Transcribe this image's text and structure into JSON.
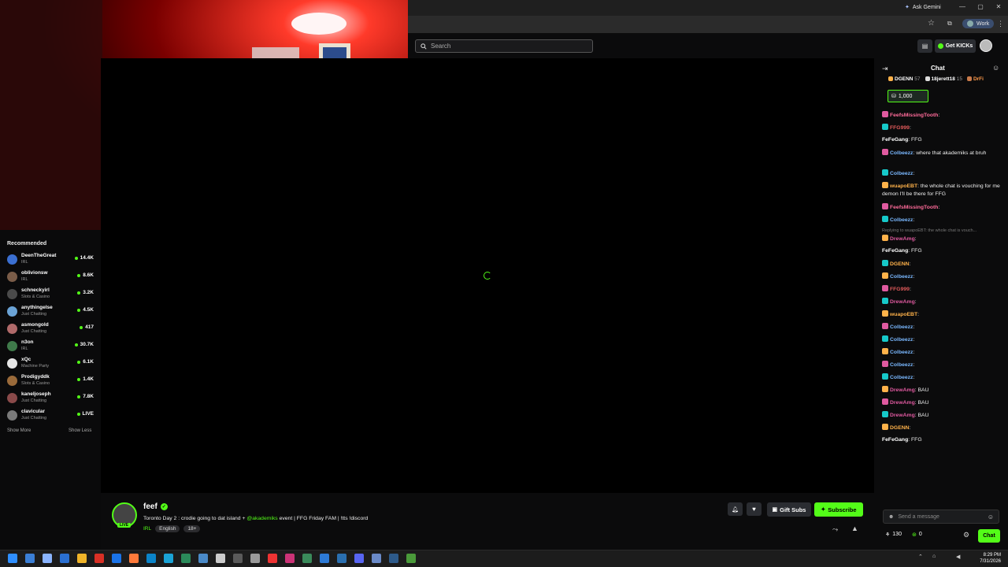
{
  "browser": {
    "ask_gemini": "Ask Gemini",
    "profile": "Work"
  },
  "header": {
    "search_placeholder": "Search",
    "get_kicks": "Get KICKs"
  },
  "sidebar": {
    "title": "Recommended",
    "items": [
      {
        "name": "DeenTheGreat",
        "category": "IRL",
        "viewers": "14.4K",
        "color": "#3b6fd1"
      },
      {
        "name": "oblivionsw",
        "category": "IRL",
        "viewers": "8.6K",
        "color": "#7a5c48"
      },
      {
        "name": "schneckyirl",
        "category": "Slots & Casino",
        "viewers": "3.2K",
        "color": "#4a4a4a"
      },
      {
        "name": "anythingelse",
        "category": "Just Chatting",
        "viewers": "4.5K",
        "color": "#6ba3d6"
      },
      {
        "name": "asmongold",
        "category": "Just Chatting",
        "viewers": "417",
        "color": "#b06a6a"
      },
      {
        "name": "n3on",
        "category": "IRL",
        "viewers": "30.7K",
        "color": "#3f7a4a"
      },
      {
        "name": "xQc",
        "category": "Machine Party",
        "viewers": "6.1K",
        "color": "#e6e6e6"
      },
      {
        "name": "Prodigyddk",
        "category": "Slots & Casino",
        "viewers": "1.4K",
        "color": "#9a6a3a"
      },
      {
        "name": "kaneljoseph",
        "category": "Just Chatting",
        "viewers": "7.8K",
        "color": "#8a4a4a"
      },
      {
        "name": "clavicular",
        "category": "Just Chatting",
        "viewers": "LIVE",
        "color": "#7a7a7a"
      }
    ],
    "show_more": "Show More",
    "show_less": "Show Less"
  },
  "stream": {
    "username": "feef",
    "title": "Toronto Day 2 : crodie going to dat island + ",
    "mention": "@akademiks",
    "title_rest": " event | FFG Friday FAM | !tts !discord",
    "category": "IRL",
    "tags": [
      "English",
      "18+"
    ],
    "live_badge": "LIVE",
    "gift_subs": "Gift Subs",
    "subscribe": "Subscribe"
  },
  "chat": {
    "title": "Chat",
    "gifters": [
      {
        "name": "DGENN",
        "count": "57"
      },
      {
        "name": "18jerett18",
        "count": "15"
      },
      {
        "name": "DrFi",
        "count": ""
      }
    ],
    "pinned_amount": "1,000",
    "reply_context": "Replying to wuapoEBT: the whole chat is vouch...",
    "messages": [
      {
        "user": "FeefsMissingTooth",
        "text": "",
        "color": "#ff6b9a"
      },
      {
        "user": "FFG999",
        "text": "",
        "color": "#e05a5a"
      },
      {
        "user": "FeFeGang",
        "text": "FFG",
        "color": "#ffffff"
      },
      {
        "user": "Colbeezz",
        "text": "where that akademiks at bruh",
        "color": "#7ab8ff"
      },
      {
        "user": "Colbeezz",
        "text": "",
        "color": "#7ab8ff"
      },
      {
        "user": "wuapoEBT",
        "text": "the whole chat is vouching for me demon I'll be there for FFG",
        "color": "#ffb24a"
      },
      {
        "user": "FeefsMissingTooth",
        "text": "",
        "color": "#ff6b9a"
      },
      {
        "user": "Colbeezz",
        "text": "",
        "color": "#7ab8ff"
      },
      {
        "user": "DrewAmg",
        "text": "",
        "color": "#e05aa0"
      },
      {
        "user": "FeFeGang",
        "text": "FFG",
        "color": "#ffffff"
      },
      {
        "user": "DGENN",
        "text": "",
        "color": "#ffb24a"
      },
      {
        "user": "Colbeezz",
        "text": "",
        "color": "#7ab8ff"
      },
      {
        "user": "FFG999",
        "text": "",
        "color": "#e05a5a"
      },
      {
        "user": "DrewAmg",
        "text": "",
        "color": "#e05aa0"
      },
      {
        "user": "wuapoEBT",
        "text": "",
        "color": "#ffb24a"
      },
      {
        "user": "Colbeezz",
        "text": "",
        "color": "#7ab8ff"
      },
      {
        "user": "Colbeezz",
        "text": "",
        "color": "#7ab8ff"
      },
      {
        "user": "Colbeezz",
        "text": "",
        "color": "#7ab8ff"
      },
      {
        "user": "Colbeezz",
        "text": "",
        "color": "#7ab8ff"
      },
      {
        "user": "Colbeezz",
        "text": "",
        "color": "#7ab8ff"
      },
      {
        "user": "DrewAmg",
        "text": "BAU",
        "color": "#e05aa0"
      },
      {
        "user": "DrewAmg",
        "text": "BAU",
        "color": "#e05aa0"
      },
      {
        "user": "DrewAmg",
        "text": "BAU",
        "color": "#e05aa0"
      },
      {
        "user": "DGENN",
        "text": "",
        "color": "#ffb24a"
      },
      {
        "user": "FeFeGang",
        "text": "FFG",
        "color": "#ffffff"
      }
    ],
    "input_placeholder": "Send a message",
    "points": "130",
    "kicks": "0",
    "send": "Chat"
  },
  "taskbar": {
    "time": "8:29 PM",
    "date": "7/31/2026"
  },
  "colors": {
    "accent": "#53fc18",
    "background": "#0b0b0c"
  }
}
